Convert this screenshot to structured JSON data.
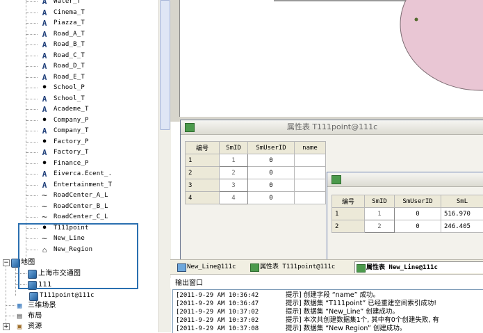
{
  "tree": {
    "layers": [
      {
        "label": "Water_T",
        "icon": "text-layer-icon"
      },
      {
        "label": "Cinema_T",
        "icon": "text-layer-icon"
      },
      {
        "label": "Piazza_T",
        "icon": "text-layer-icon"
      },
      {
        "label": "Road_A_T",
        "icon": "text-layer-icon"
      },
      {
        "label": "Road_B_T",
        "icon": "text-layer-icon"
      },
      {
        "label": "Road_C_T",
        "icon": "text-layer-icon"
      },
      {
        "label": "Road_D_T",
        "icon": "text-layer-icon"
      },
      {
        "label": "Road_E_T",
        "icon": "text-layer-icon"
      },
      {
        "label": "School_P",
        "icon": "point-layer-icon"
      },
      {
        "label": "School_T",
        "icon": "text-layer-icon"
      },
      {
        "label": "Academe_T",
        "icon": "text-layer-icon"
      },
      {
        "label": "Company_P",
        "icon": "point-layer-icon"
      },
      {
        "label": "Company_T",
        "icon": "text-layer-icon"
      },
      {
        "label": "Factory_P",
        "icon": "point-layer-icon"
      },
      {
        "label": "Factory_T",
        "icon": "text-layer-icon"
      },
      {
        "label": "Finance_P",
        "icon": "point-layer-icon"
      },
      {
        "label": "Eiverca.Ecent_.",
        "icon": "text-layer-icon"
      },
      {
        "label": "Entertainment_T",
        "icon": "text-layer-icon"
      },
      {
        "label": "RoadCenter_A_L",
        "icon": "line-layer-icon"
      },
      {
        "label": "RoadCenter_B_L",
        "icon": "line-layer-icon"
      },
      {
        "label": "RoadCenter_C_L",
        "icon": "line-layer-icon"
      },
      {
        "label": "T111point",
        "icon": "point-layer-icon"
      },
      {
        "label": "New_Line",
        "icon": "line-layer-icon"
      },
      {
        "label": "New_Region",
        "icon": "region-layer-icon"
      }
    ],
    "map_node": {
      "label": "地图",
      "expander": "−"
    },
    "maps": [
      {
        "label": "上海市交通图"
      },
      {
        "label": "111"
      }
    ],
    "t111_node": {
      "label": "T111point@111c"
    },
    "scene_node": {
      "label": "三维场景"
    },
    "layout_node": {
      "label": "布局"
    },
    "resource_node": {
      "label": "资源",
      "expander": "+"
    }
  },
  "table1": {
    "title": "属性表 T111point@111c",
    "columns": [
      "编号",
      "SmID",
      "SmUserID",
      "name"
    ],
    "rows": [
      {
        "no": "1",
        "smid": "1",
        "smuserid": "0",
        "name": ""
      },
      {
        "no": "2",
        "smid": "2",
        "smuserid": "0",
        "name": ""
      },
      {
        "no": "3",
        "smid": "3",
        "smuserid": "0",
        "name": ""
      },
      {
        "no": "4",
        "smid": "4",
        "smuserid": "0",
        "name": ""
      }
    ]
  },
  "table2": {
    "columns": [
      "编号",
      "SmID",
      "SmUserID",
      "SmL"
    ],
    "rows": [
      {
        "no": "1",
        "smid": "1",
        "smuserid": "0",
        "sml": "516.970"
      },
      {
        "no": "2",
        "smid": "2",
        "smuserid": "0",
        "sml": "246.405"
      }
    ]
  },
  "tabs": [
    {
      "label": "New_Line@111c",
      "active": false
    },
    {
      "label": "属性表 T111point@111c",
      "active": false
    },
    {
      "label": "属性表 New_Line@111c",
      "active": true
    }
  ],
  "output": {
    "title": "输出窗口",
    "lines": [
      {
        "time": "[2011-9-29 AM 10:36:42",
        "msg": "提示] 创建字段 “name” 成功。"
      },
      {
        "time": "[2011-9-29 AM 10:36:47",
        "msg": "提示] 数据集 “T111point” 已经重建空间索引成功!"
      },
      {
        "time": "[2011-9-29 AM 10:37:02",
        "msg": "提示] 数据集 “New_Line” 创建成功。"
      },
      {
        "time": "[2011-9-29 AM 10:37:02",
        "msg": "提示] 本次共创建数据集1个, 其中有0个创建失败, 有"
      },
      {
        "time": "[2011-9-29 AM 10:37:08",
        "msg": "提示] 数据集 “New Region” 创建成功。"
      }
    ]
  },
  "colors": {
    "highlight": "#2a6fb0",
    "region_fill": "#e9c6d4",
    "grid_header": "#ece9d8"
  }
}
